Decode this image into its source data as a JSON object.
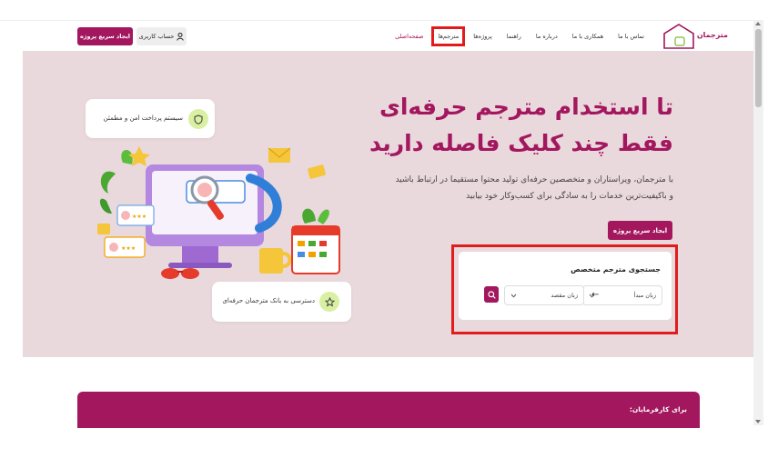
{
  "header": {
    "logo_text": "مترجمان",
    "nav": [
      {
        "label": "صفحه‌اصلی",
        "active": true,
        "highlighted": false
      },
      {
        "label": "مترجم‌ها",
        "active": false,
        "highlighted": true
      },
      {
        "label": "پروژه‌ها",
        "active": false,
        "highlighted": false
      },
      {
        "label": "راهنما",
        "active": false,
        "highlighted": false
      },
      {
        "label": "درباره ما",
        "active": false,
        "highlighted": false
      },
      {
        "label": "همکاری با ما",
        "active": false,
        "highlighted": false
      },
      {
        "label": "تماس با ما",
        "active": false,
        "highlighted": false
      }
    ],
    "account_label": "حساب کاربری",
    "quick_project_label": "ایجاد سریع پروژه"
  },
  "hero": {
    "title_line1": "تا استخدام مترجم حرفه‌ای",
    "title_line2": "فقط چند کلیک فاصله دارید",
    "description_line1": "با مترجمان، ویراستاران و متخصصین حرفه‌ای تولید محتوا مستقیما در ارتباط باشید",
    "description_line2": "و باکیفیت‌ترین خدمات را به سادگی برای کسب‌وکار خود بیابید",
    "quick_project_label": "ایجاد سریع پروژه",
    "payment_card_text": "سیستم پرداخت امن و مطمئن",
    "bank_card_text": "دسترسی به بانک مترجمان حرفه‌ای"
  },
  "search": {
    "title": "جستجوی مترجم متخصص",
    "source_language": "زبان مبدأ",
    "target_language": "زبان مقصد",
    "arrow": "←"
  },
  "employers": {
    "label": "برای کارفرمایان:"
  },
  "colors": {
    "brand": "#a3175e",
    "hero_bg": "#e9d8dc",
    "highlight": "#e01c1c",
    "badge_green": "#d9f0a3"
  }
}
